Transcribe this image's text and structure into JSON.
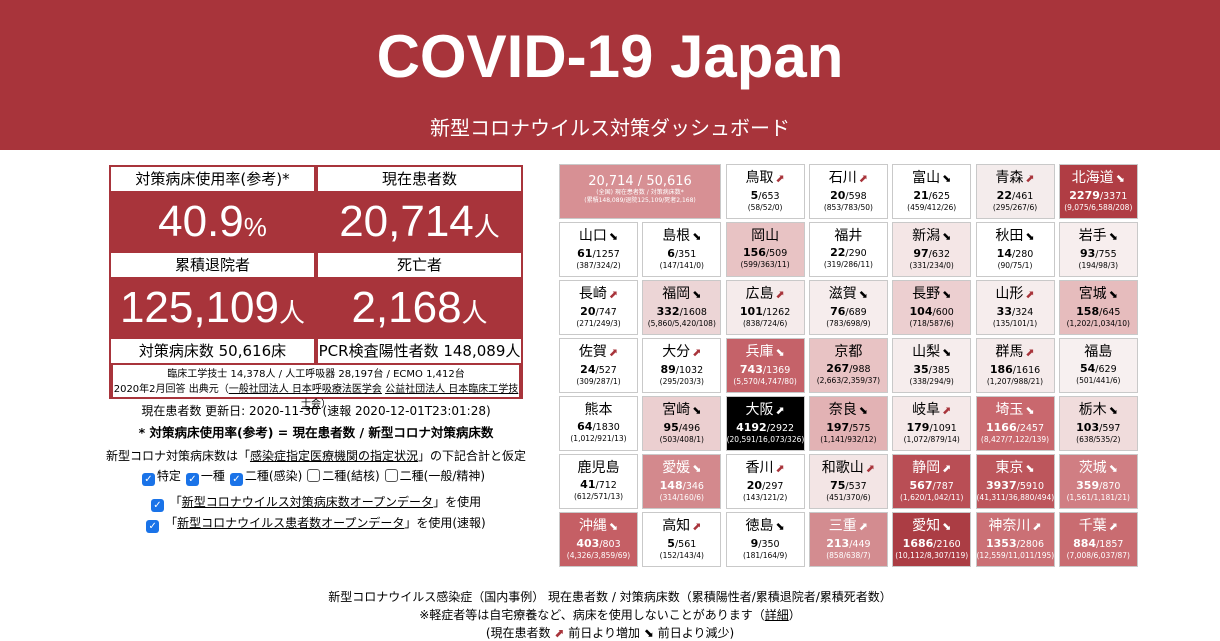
{
  "header": {
    "title": "COVID-19 Japan",
    "subtitle": "新型コロナウイルス対策ダッシュボード"
  },
  "stats": {
    "bed_rate_label": "対策病床使用率(参考)*",
    "bed_rate_value": "40.9",
    "bed_rate_unit": "%",
    "current_label": "現在患者数",
    "current_value": "20,714",
    "current_unit": "人",
    "discharged_label": "累積退院者",
    "discharged_value": "125,109",
    "discharged_unit": "人",
    "deaths_label": "死亡者",
    "deaths_value": "2,168",
    "deaths_unit": "人",
    "beds_text": "対策病床数 50,616床",
    "pcr_text": "PCR検査陽性者数 148,089人",
    "note1": "臨床工学技士 14,378人 / 人工呼吸器 28,197台 / ECMO 1,412台",
    "note2_prefix": "2020年2月回答 出典元（",
    "note2_link1": "一般社団法人 日本呼吸療法医学会",
    "note2_link2": "公益社団法人 日本臨床工学技士会",
    "note2_suffix": "）"
  },
  "info": {
    "updated": "現在患者数 更新日: 2020-11-30 (速報 2020-12-01T23:01:28)",
    "formula": "* 対策病床使用率(参考) = 現在患者数 / 新型コロナ対策病床数",
    "assume_prefix": "新型コロナ対策病床数は「",
    "assume_link": "感染症指定医療機関の指定状況",
    "assume_suffix": "」の下記合計と仮定",
    "checks": [
      {
        "label": "特定",
        "checked": true
      },
      {
        "label": "一種",
        "checked": true
      },
      {
        "label": "二種(感染)",
        "checked": true
      },
      {
        "label": "二種(結核)",
        "checked": false
      },
      {
        "label": "二種(一般/精神)",
        "checked": false
      }
    ],
    "opt1_prefix": "「",
    "opt1_link": "新型コロナウイルス対策病床数オープンデータ",
    "opt1_suffix": "」を使用",
    "opt2_prefix": "「",
    "opt2_link": "新型コロナウイルス患者数オープンデータ",
    "opt2_suffix": "」を使用(速報)"
  },
  "total_cell": {
    "main": "20,714 / 50,616",
    "line1": "(全国) 現在患者数 / 対策病床数*",
    "line2": "(累積148,089/退院125,109/死者2,168)"
  },
  "colors": {
    "brand": "#a8343b"
  },
  "prefectures": [
    {
      "name": "鳥取",
      "trend": "up",
      "current": "5",
      "beds": "653",
      "sub": "(58/52/0)",
      "color": "#ffffff"
    },
    {
      "name": "石川",
      "trend": "up",
      "current": "20",
      "beds": "598",
      "sub": "(853/783/50)",
      "color": "#ffffff"
    },
    {
      "name": "富山",
      "trend": "down",
      "current": "21",
      "beds": "625",
      "sub": "(459/412/26)",
      "color": "#ffffff"
    },
    {
      "name": "青森",
      "trend": "up",
      "current": "22",
      "beds": "461",
      "sub": "(295/267/6)",
      "color": "#f4ecec"
    },
    {
      "name": "北海道",
      "trend": "down",
      "current": "2279",
      "beds": "3371",
      "sub": "(9,075/6,588/208)",
      "color": "#b03d44",
      "dark": true
    },
    {
      "name": "山口",
      "trend": "down",
      "current": "61",
      "beds": "1257",
      "sub": "(387/324/2)",
      "color": "#ffffff"
    },
    {
      "name": "島根",
      "trend": "down",
      "current": "6",
      "beds": "351",
      "sub": "(147/141/0)",
      "color": "#ffffff"
    },
    {
      "name": "岡山",
      "trend": "",
      "current": "156",
      "beds": "509",
      "sub": "(599/363/11)",
      "color": "#e8c3c4"
    },
    {
      "name": "福井",
      "trend": "",
      "current": "22",
      "beds": "290",
      "sub": "(319/286/11)",
      "color": "#ffffff"
    },
    {
      "name": "新潟",
      "trend": "down",
      "current": "97",
      "beds": "632",
      "sub": "(331/234/0)",
      "color": "#f4e6e6"
    },
    {
      "name": "秋田",
      "trend": "down",
      "current": "14",
      "beds": "280",
      "sub": "(90/75/1)",
      "color": "#ffffff"
    },
    {
      "name": "岩手",
      "trend": "down",
      "current": "93",
      "beds": "755",
      "sub": "(194/98/3)",
      "color": "#f7eeee"
    },
    {
      "name": "長崎",
      "trend": "up",
      "current": "20",
      "beds": "747",
      "sub": "(271/249/3)",
      "color": "#ffffff"
    },
    {
      "name": "福岡",
      "trend": "down",
      "current": "332",
      "beds": "1608",
      "sub": "(5,860/5,420/108)",
      "color": "#ecd5d6"
    },
    {
      "name": "広島",
      "trend": "up",
      "current": "101",
      "beds": "1262",
      "sub": "(838/724/6)",
      "color": "#f5ebeb"
    },
    {
      "name": "滋賀",
      "trend": "down",
      "current": "76",
      "beds": "689",
      "sub": "(783/698/9)",
      "color": "#f6eded"
    },
    {
      "name": "長野",
      "trend": "down",
      "current": "104",
      "beds": "600",
      "sub": "(718/587/6)",
      "color": "#eccfd0"
    },
    {
      "name": "山形",
      "trend": "up",
      "current": "33",
      "beds": "324",
      "sub": "(135/101/1)",
      "color": "#f6eded"
    },
    {
      "name": "宮城",
      "trend": "down",
      "current": "158",
      "beds": "645",
      "sub": "(1,202/1,034/10)",
      "color": "#e6bcbd"
    },
    {
      "name": "佐賀",
      "trend": "up",
      "current": "24",
      "beds": "527",
      "sub": "(309/287/1)",
      "color": "#ffffff"
    },
    {
      "name": "大分",
      "trend": "up",
      "current": "89",
      "beds": "1032",
      "sub": "(295/203/3)",
      "color": "#ffffff"
    },
    {
      "name": "兵庫",
      "trend": "down",
      "current": "743",
      "beds": "1369",
      "sub": "(5,570/4,747/80)",
      "color": "#c56269",
      "dark": true
    },
    {
      "name": "京都",
      "trend": "",
      "current": "267",
      "beds": "988",
      "sub": "(2,663/2,359/37)",
      "color": "#e8c3c4"
    },
    {
      "name": "山梨",
      "trend": "down",
      "current": "35",
      "beds": "385",
      "sub": "(338/294/9)",
      "color": "#f6eded"
    },
    {
      "name": "群馬",
      "trend": "up",
      "current": "186",
      "beds": "1616",
      "sub": "(1,207/988/21)",
      "color": "#f5ebeb"
    },
    {
      "name": "福島",
      "trend": "",
      "current": "54",
      "beds": "629",
      "sub": "(501/441/6)",
      "color": "#f7f0f0"
    },
    {
      "name": "熊本",
      "trend": "",
      "current": "64",
      "beds": "1830",
      "sub": "(1,012/921/13)",
      "color": "#ffffff"
    },
    {
      "name": "宮崎",
      "trend": "down",
      "current": "95",
      "beds": "496",
      "sub": "(503/408/1)",
      "color": "#ebcfd0"
    },
    {
      "name": "大阪",
      "trend": "up",
      "current": "4192",
      "beds": "2922",
      "sub": "(20,591/16,073/326)",
      "color": "#000000",
      "dark": true
    },
    {
      "name": "奈良",
      "trend": "down",
      "current": "197",
      "beds": "575",
      "sub": "(1,141/932/12)",
      "color": "#e2b2b4"
    },
    {
      "name": "岐阜",
      "trend": "up",
      "current": "179",
      "beds": "1091",
      "sub": "(1,072/879/14)",
      "color": "#f5e9e9"
    },
    {
      "name": "埼玉",
      "trend": "down",
      "current": "1166",
      "beds": "2457",
      "sub": "(8,427/7,122/139)",
      "color": "#c9686e",
      "dark": true
    },
    {
      "name": "栃木",
      "trend": "down",
      "current": "103",
      "beds": "597",
      "sub": "(638/535/2)",
      "color": "#f0dcdc"
    },
    {
      "name": "鹿児島",
      "trend": "",
      "current": "41",
      "beds": "712",
      "sub": "(612/571/13)",
      "color": "#ffffff"
    },
    {
      "name": "愛媛",
      "trend": "down",
      "current": "148",
      "beds": "346",
      "sub": "(314/160/6)",
      "color": "#d3898d",
      "dark": true
    },
    {
      "name": "香川",
      "trend": "up",
      "current": "20",
      "beds": "297",
      "sub": "(143/121/2)",
      "color": "#ffffff"
    },
    {
      "name": "和歌山",
      "trend": "up",
      "current": "75",
      "beds": "537",
      "sub": "(451/370/6)",
      "color": "#f3e5e5"
    },
    {
      "name": "静岡",
      "trend": "up",
      "current": "567",
      "beds": "787",
      "sub": "(1,620/1,042/11)",
      "color": "#b94e55",
      "dark": true
    },
    {
      "name": "東京",
      "trend": "down",
      "current": "3937",
      "beds": "5910",
      "sub": "(41,311/36,880/494)",
      "color": "#bd565c",
      "dark": true
    },
    {
      "name": "茨城",
      "trend": "down",
      "current": "359",
      "beds": "870",
      "sub": "(1,561/1,181/21)",
      "color": "#d07e83",
      "dark": true
    },
    {
      "name": "沖縄",
      "trend": "down",
      "current": "403",
      "beds": "803",
      "sub": "(4,326/3,859/69)",
      "color": "#c55f65",
      "dark": true
    },
    {
      "name": "高知",
      "trend": "up",
      "current": "5",
      "beds": "561",
      "sub": "(152/143/4)",
      "color": "#ffffff"
    },
    {
      "name": "徳島",
      "trend": "down",
      "current": "9",
      "beds": "350",
      "sub": "(181/164/9)",
      "color": "#ffffff"
    },
    {
      "name": "三重",
      "trend": "up",
      "current": "213",
      "beds": "449",
      "sub": "(858/638/7)",
      "color": "#d38c90",
      "dark": true
    },
    {
      "name": "愛知",
      "trend": "down",
      "current": "1686",
      "beds": "2160",
      "sub": "(10,112/8,307/119)",
      "color": "#ab3d44",
      "dark": true
    },
    {
      "name": "神奈川",
      "trend": "up",
      "current": "1353",
      "beds": "2806",
      "sub": "(12,559/11,011/195)",
      "color": "#cb7075",
      "dark": true
    },
    {
      "name": "千葉",
      "trend": "up",
      "current": "884",
      "beds": "1857",
      "sub": "(7,008/6,037/87)",
      "color": "#c96c71",
      "dark": true
    }
  ],
  "bottom": {
    "line1": "新型コロナウイルス感染症（国内事例） 現在患者数 / 対策病床数（累積陽性者/累積退院者/累積死者数）",
    "line2_prefix": "※軽症者等は自宅療養など、病床を使用しないことがあります（",
    "line2_link": "詳細",
    "line2_suffix": "）",
    "legend_prefix": "(現在患者数",
    "legend_up": "前日より増加",
    "legend_down": "前日より減少)"
  }
}
